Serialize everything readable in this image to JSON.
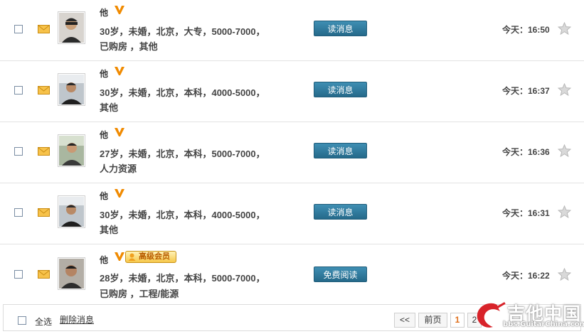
{
  "messages": [
    {
      "name": "他",
      "details": "30岁，未婚，北京，大专，5000-7000，",
      "details2": "已购房  ，其他",
      "button": "读消息",
      "time": "今天：16:50",
      "badge": ""
    },
    {
      "name": "他",
      "details": "30岁，未婚，北京，本科，4000-5000，",
      "details2": "其他",
      "button": "读消息",
      "time": "今天：16:37",
      "badge": ""
    },
    {
      "name": "他",
      "details": "27岁，未婚，北京，本科，5000-7000，",
      "details2": "人力资源",
      "button": "读消息",
      "time": "今天：16:36",
      "badge": ""
    },
    {
      "name": "他",
      "details": "30岁，未婚，北京，本科，4000-5000，",
      "details2": "其他",
      "button": "读消息",
      "time": "今天：16:31",
      "badge": ""
    },
    {
      "name": "他",
      "details": "28岁，未婚，北京，本科，5000-7000，",
      "details2": "已购房  ，工程/能源",
      "button": "免费阅读",
      "time": "今天：16:22",
      "badge": "高级会员"
    }
  ],
  "footer": {
    "select_all": "全选",
    "delete": "删除消息",
    "pagination": {
      "prev_all": "<<",
      "prev": "前页",
      "current": "1",
      "next": "2"
    }
  },
  "watermark": {
    "title": "吉他中国",
    "url": "bbs.GuitarChina.com"
  },
  "colors": {
    "button": "#2f7ea3",
    "accent_orange": "#f08a00",
    "page_current": "#e0701c"
  }
}
